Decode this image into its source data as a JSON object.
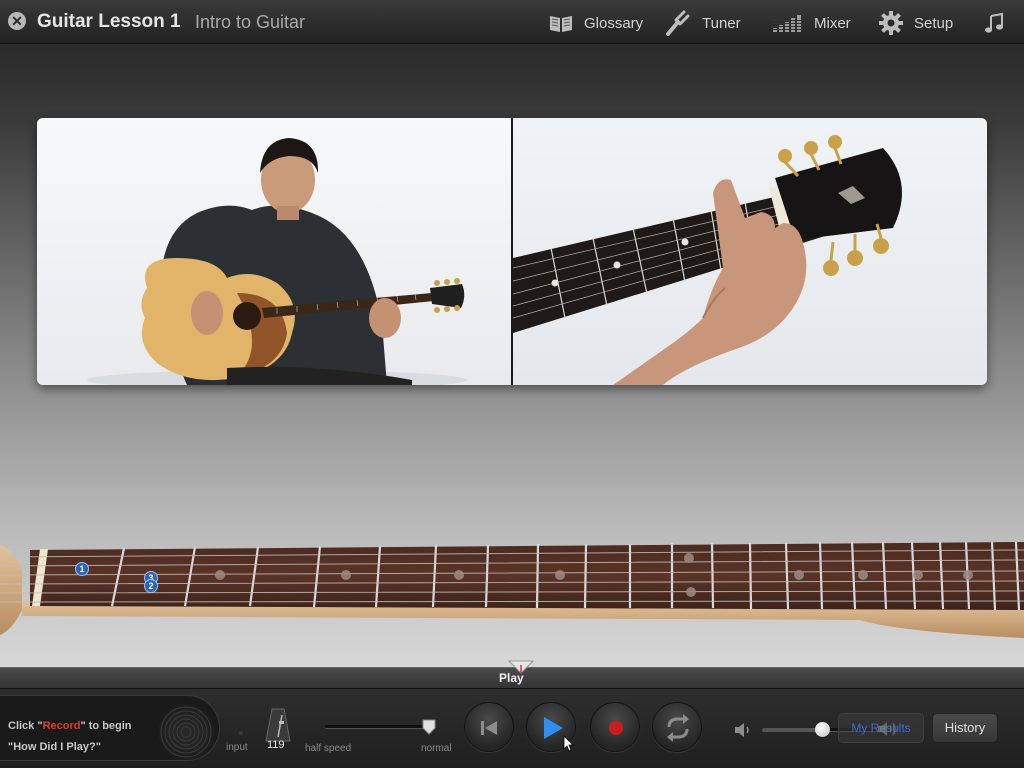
{
  "titlebar": {
    "app_title": "Guitar Lesson 1",
    "subtitle": "Intro to Guitar",
    "nav": {
      "glossary": "Glossary",
      "tuner": "Tuner",
      "mixer": "Mixer",
      "setup": "Setup"
    },
    "icons": [
      "close-icon",
      "book-icon",
      "tuning-fork-icon",
      "mixer-bars-icon",
      "gear-icon",
      "music-note-icon"
    ]
  },
  "fretboard": {
    "finger_markers": [
      "1",
      "3",
      "2"
    ]
  },
  "timeline": {
    "playhead_label": "Play"
  },
  "controls": {
    "hint_prefix": "Click \"",
    "hint_keyword": "Record",
    "hint_suffix": "\" to begin",
    "hint_line2": "\"How Did I Play?\"",
    "input_label": "input",
    "tempo": "119",
    "speed_min_label": "half speed",
    "speed_max_label": "normal",
    "speed_level": 1.0,
    "volume_level": 0.5,
    "my_results": "My Results",
    "history": "History"
  },
  "colors": {
    "record_accent": "#e23b2f",
    "play_blue": "#2f8ef0",
    "finger_marker": "#2d63b8"
  }
}
